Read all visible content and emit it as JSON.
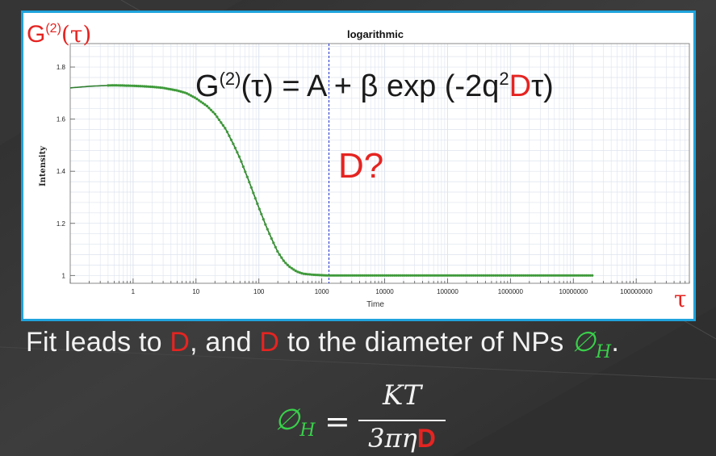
{
  "corner_label": {
    "g": "G",
    "sup": "(2)",
    "tau": "(τ)"
  },
  "equation": {
    "g": "G",
    "sup": "(2)",
    "lhs_rest": "(τ) = A + β exp (-2q",
    "q_sup": "2",
    "d": "D",
    "close": "τ)"
  },
  "question": "D?",
  "caption": {
    "part1": "Fit  leads to ",
    "d1": "D",
    "part2": ", and ",
    "d2": "D",
    "part3": " to the  diameter of NPs ",
    "phi": "∅",
    "phi_sub": "H",
    "period": "."
  },
  "formula": {
    "phi": "∅",
    "phi_sub": "H",
    "equals": "=",
    "numerator": "KT",
    "denominator_prefix": "3πη",
    "denominator_d": "D"
  },
  "tau_axis_symbol": "τ",
  "colors": {
    "panel_border": "#1fa3dc",
    "curve": "#2f7d2f",
    "curve_points": "#3f9a3a",
    "accent_red": "#e52421",
    "accent_green": "#39d04a",
    "marker_line": "#2233cc",
    "grid": "#dde3ee"
  },
  "chart_data": {
    "type": "scatter",
    "title": "logarithmic",
    "xlabel": "Time",
    "ylabel": "Intensity",
    "xscale": "log",
    "xlim": [
      0.1,
      700000000
    ],
    "ylim": [
      0.97,
      1.89
    ],
    "x_ticks": [
      {
        "value": 1,
        "label": "1"
      },
      {
        "value": 10,
        "label": "10"
      },
      {
        "value": 100,
        "label": "100"
      },
      {
        "value": 1000,
        "label": "1000"
      },
      {
        "value": 10000,
        "label": "10000"
      },
      {
        "value": 100000,
        "label": "100000"
      },
      {
        "value": 1000000,
        "label": "1000000"
      },
      {
        "value": 10000000,
        "label": "10000000"
      },
      {
        "value": 100000000,
        "label": "100000000"
      }
    ],
    "y_ticks": [
      {
        "value": 1,
        "label": "1"
      },
      {
        "value": 1.2,
        "label": "1.2"
      },
      {
        "value": 1.4,
        "label": "1.4"
      },
      {
        "value": 1.6,
        "label": "1.6"
      },
      {
        "value": 1.8,
        "label": "1.8"
      }
    ],
    "grid": true,
    "vertical_marker_x": 1300,
    "series": [
      {
        "x": [
          0.1,
          0.2,
          0.3,
          0.5,
          0.7,
          1,
          1.5,
          2,
          3,
          5,
          7,
          10,
          15,
          20,
          30,
          40,
          50,
          70,
          100,
          130,
          160,
          200,
          250,
          300,
          400,
          500,
          700,
          1000,
          1300,
          2000,
          5000,
          10000,
          100000,
          1000000,
          10000000,
          20000000
        ],
        "y": [
          1.72,
          1.726,
          1.728,
          1.73,
          1.729,
          1.728,
          1.726,
          1.724,
          1.72,
          1.71,
          1.7,
          1.68,
          1.65,
          1.62,
          1.56,
          1.5,
          1.45,
          1.36,
          1.26,
          1.19,
          1.14,
          1.09,
          1.055,
          1.035,
          1.015,
          1.007,
          1.003,
          1.001,
          1.0,
          1.0,
          1.0,
          1.0,
          1.0,
          1.0,
          1.0,
          1.0
        ]
      }
    ]
  }
}
